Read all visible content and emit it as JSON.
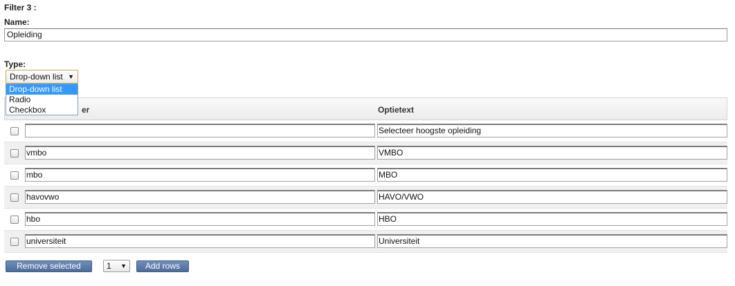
{
  "filter": {
    "heading": "Filter 3 :",
    "name_label": "Name:",
    "name_value": "Opleiding",
    "type_label": "Type:",
    "type_selected": "Drop-down list",
    "type_options": [
      "Drop-down list",
      "Radio",
      "Checkbox"
    ]
  },
  "table": {
    "col1_header_partial": "er",
    "col2_header": "Optietext",
    "rows": [
      {
        "value": "",
        "text": "Selecteer hoogste opleiding"
      },
      {
        "value": "vmbo",
        "text": "VMBO"
      },
      {
        "value": "mbo",
        "text": "MBO"
      },
      {
        "value": "havovwo",
        "text": "HAVO/VWO"
      },
      {
        "value": "hbo",
        "text": "HBO"
      },
      {
        "value": "universiteit",
        "text": "Universiteit"
      }
    ]
  },
  "actions": {
    "remove_label": "Remove selected",
    "rows_count": "1",
    "add_label": "Add rows"
  },
  "icons": {
    "select_arrow": "chevron-down-icon"
  }
}
